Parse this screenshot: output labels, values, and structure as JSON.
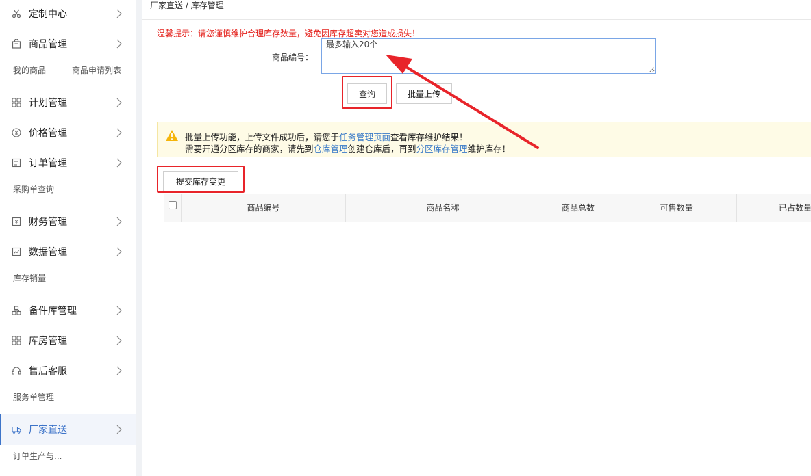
{
  "sidebar": {
    "menu": [
      {
        "label": "定制中心",
        "icon": "scissors-icon"
      },
      {
        "label": "商品管理",
        "icon": "bag-icon"
      },
      {
        "label": "计划管理",
        "icon": "grid-icon"
      },
      {
        "label": "价格管理",
        "icon": "yen-coin-icon"
      },
      {
        "label": "订单管理",
        "icon": "order-list-icon"
      },
      {
        "label": "财务管理",
        "icon": "wallet-icon"
      },
      {
        "label": "数据管理",
        "icon": "chart-icon"
      },
      {
        "label": "备件库管理",
        "icon": "parts-icon"
      },
      {
        "label": "库房管理",
        "icon": "warehouse-grid-icon"
      },
      {
        "label": "售后客服",
        "icon": "headset-icon"
      },
      {
        "label": "厂家直送",
        "icon": "truck-icon",
        "active": true
      }
    ],
    "sub": {
      "my_goods": "我的商品",
      "goods_apply_list": "商品申请列表",
      "purchase_query": "采购单查询",
      "stock_sales": "库存销量",
      "service_orders": "服务单管理",
      "order_production": "订单生产与..."
    }
  },
  "breadcrumb": "厂家直送 / 库存管理",
  "tip": "温馨提示：请您谨慎维护合理库存数量，避免因库存超卖对您造成损失！",
  "form": {
    "code_label": "商品编号：",
    "code_placeholder": "最多输入20个",
    "query_button": "查询",
    "batch_upload_button": "批量上传"
  },
  "notice": {
    "line1_a": "批量上传功能，上传文件成功后，请您于",
    "line1_link": "任务管理页面",
    "line1_b": "查看库存维护结果！",
    "line2_a": "需要开通分区库存的商家，请先到",
    "line2_link1": "仓库管理",
    "line2_b": "创建仓库后，再到",
    "line2_link2": "分区库存管理",
    "line2_c": "维护库存！"
  },
  "submit_button": "提交库存变更",
  "table": {
    "headers": [
      "商品编号",
      "商品名称",
      "商品总数",
      "可售数量",
      "已占数量"
    ]
  },
  "colors": {
    "accent": "#3d74c9",
    "warning_red": "#e4201b",
    "highlight_red": "#e8242a"
  }
}
